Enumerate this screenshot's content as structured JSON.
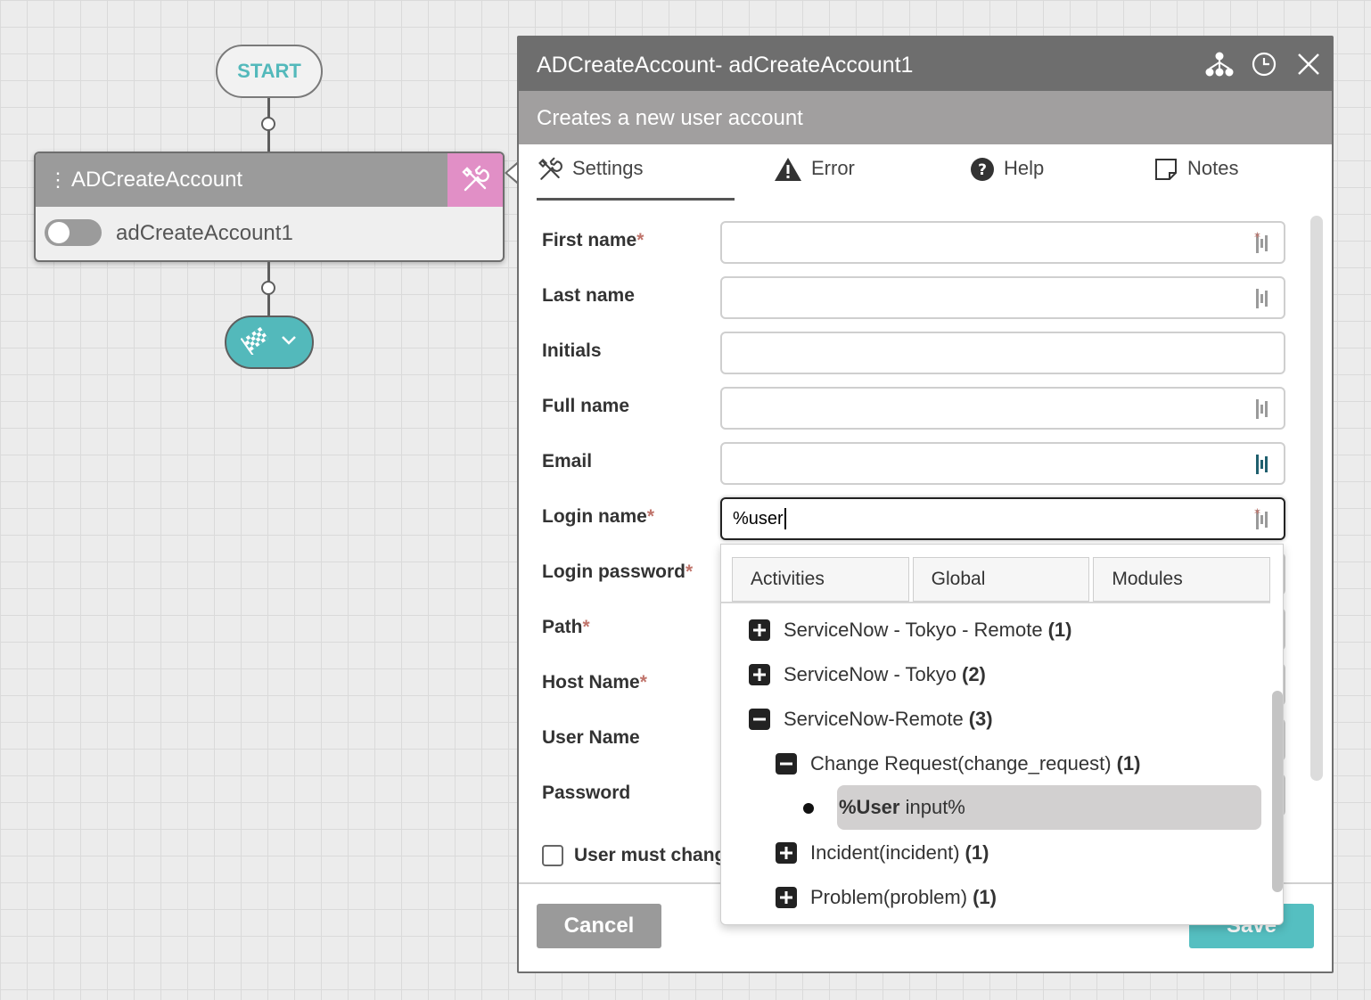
{
  "canvas": {
    "start_label": "START",
    "activity": {
      "name": "ADCreateAccount",
      "instance": "adCreateAccount1"
    }
  },
  "panel": {
    "title": "ADCreateAccount-  adCreateAccount1",
    "subtitle": "Creates a new user account",
    "header_icons": [
      "hierarchy-icon",
      "history-icon",
      "close-icon"
    ],
    "tabs": [
      {
        "label": "Settings",
        "icon": "tools-icon",
        "active": true
      },
      {
        "label": "Error",
        "icon": "warning-icon"
      },
      {
        "label": "Help",
        "icon": "help-icon"
      },
      {
        "label": "Notes",
        "icon": "note-icon"
      }
    ],
    "fields": {
      "first_name": {
        "label": "First name",
        "required": "*",
        "value": ""
      },
      "last_name": {
        "label": "Last name",
        "value": ""
      },
      "initials": {
        "label": "Initials",
        "value": ""
      },
      "full_name": {
        "label": "Full name",
        "value": ""
      },
      "email": {
        "label": "Email",
        "value": ""
      },
      "login_name": {
        "label": "Login name",
        "required": "*",
        "value": "%user"
      },
      "login_password": {
        "label": "Login password",
        "required": "*"
      },
      "path": {
        "label": "Path",
        "required": "*"
      },
      "host_name": {
        "label": "Host Name",
        "required": "*"
      },
      "user_name": {
        "label": "User Name"
      },
      "password": {
        "label": "Password"
      }
    },
    "checkbox_label": "User must change",
    "cancel_label": "Cancel",
    "save_label": "Save"
  },
  "dropdown": {
    "tabs": [
      "Activities",
      "Global",
      "Modules"
    ],
    "items": [
      {
        "label": "ServiceNow - Tokyo - Remote",
        "count": "(1)",
        "state": "collapsed"
      },
      {
        "label": "ServiceNow - Tokyo",
        "count": "(2)",
        "state": "collapsed"
      },
      {
        "label": "ServiceNow-Remote",
        "count": "(3)",
        "state": "expanded"
      },
      {
        "label": "Change Request(change_request)",
        "count": "(1)",
        "state": "expanded"
      },
      {
        "label": "Incident(incident)",
        "count": "(1)",
        "state": "collapsed"
      },
      {
        "label": "Problem(problem)",
        "count": "(1)",
        "state": "collapsed"
      }
    ],
    "selected_leaf": {
      "bold": "%User",
      "rest": " input%"
    }
  },
  "colors": {
    "accent_teal": "#53b9bb",
    "tool_pink": "#e18fc6",
    "required_red": "#c0746b",
    "header_gray": "#6e6e6e",
    "subheader_gray": "#a19f9f"
  }
}
